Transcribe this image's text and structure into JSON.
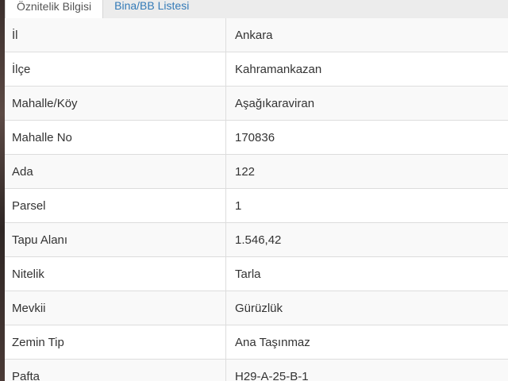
{
  "tabs": [
    {
      "label": "Öznitelik Bilgisi"
    },
    {
      "label": "Bina/BB Listesi"
    }
  ],
  "rows": [
    {
      "label": "İl",
      "value": "Ankara"
    },
    {
      "label": "İlçe",
      "value": "Kahramankazan"
    },
    {
      "label": "Mahalle/Köy",
      "value": "Aşağıkaraviran"
    },
    {
      "label": "Mahalle No",
      "value": "170836"
    },
    {
      "label": "Ada",
      "value": "122"
    },
    {
      "label": "Parsel",
      "value": "1"
    },
    {
      "label": "Tapu Alanı",
      "value": "1.546,42"
    },
    {
      "label": "Nitelik",
      "value": "Tarla"
    },
    {
      "label": "Mevkii",
      "value": "Gürüzlük"
    },
    {
      "label": "Zemin Tip",
      "value": "Ana Taşınmaz"
    },
    {
      "label": "Pafta",
      "value": "H29-A-25-B-1"
    }
  ]
}
